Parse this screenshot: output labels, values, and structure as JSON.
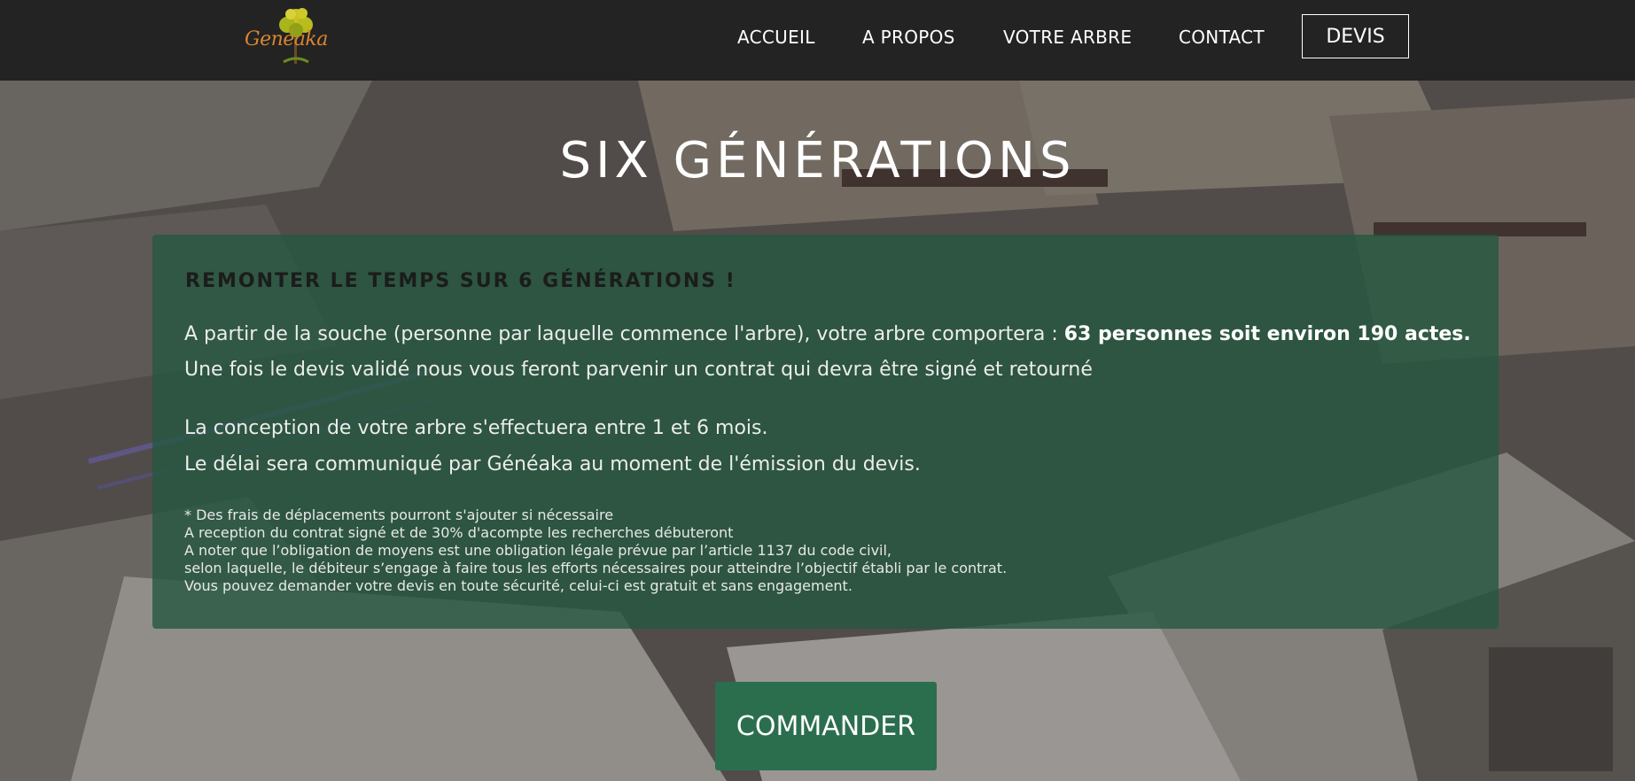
{
  "brand": {
    "logo_text": "Genéaka",
    "logo_icon": "tree-icon"
  },
  "nav": {
    "items": [
      {
        "label": "ACCUEIL"
      },
      {
        "label": "A PROPOS"
      },
      {
        "label": "VOTRE ARBRE"
      },
      {
        "label": "CONTACT"
      }
    ],
    "devis_label": "DEVIS"
  },
  "hero": {
    "title": "SIX GÉNÉRATIONS"
  },
  "card": {
    "heading": "REMONTER LE TEMPS SUR 6 GÉNÉRATIONS !",
    "line1_prefix": "A partir de la souche (personne par laquelle commence l'arbre), votre arbre comportera : ",
    "line1_bold": "63 personnes soit environ 190 actes.",
    "line2": "Une fois le devis validé nous vous feront parvenir un contrat qui devra être signé et retourné",
    "line3": "La conception de votre arbre s'effectuera entre 1 et 6 mois.",
    "line4": "Le délai sera communiqué par Généaka au moment de l'émission du devis.",
    "notes": [
      "* Des frais de déplacements pourront s'ajouter si nécessaire",
      "A reception du contrat signé et de 30% d'acompte les recherches débuteront",
      "A noter que l’obligation de moyens est une obligation légale prévue par l’article 1137 du code civil,",
      "selon laquelle, le débiteur s’engage à faire tous les efforts nécessaires pour atteindre l’objectif établi par le contrat.",
      "Vous pouvez demander votre devis en toute sécurité, celui-ci est gratuit et sans engagement."
    ]
  },
  "cta": {
    "label": "COMMANDER"
  },
  "colors": {
    "nav_bg": "#232323",
    "card_bg": "#245840",
    "cta_bg": "#2b6e4e",
    "logo_orange": "#d9852f"
  }
}
